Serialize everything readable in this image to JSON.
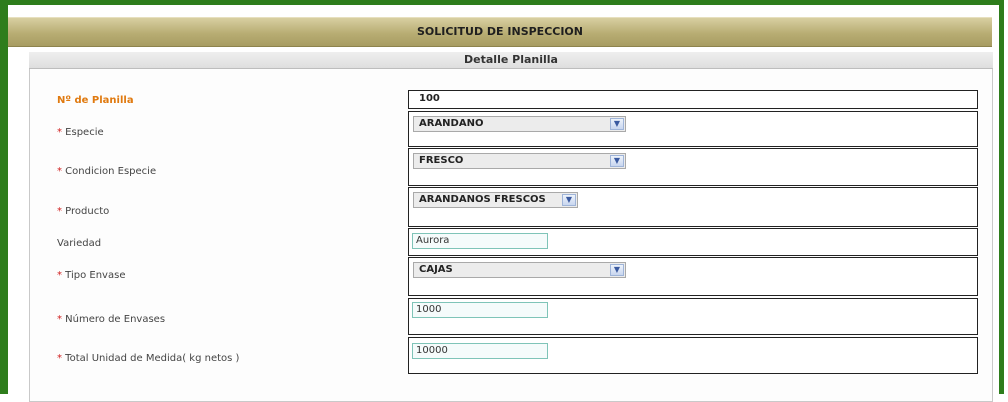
{
  "title": "SOLICITUD DE INSPECCION",
  "section": "Detalle Planilla",
  "fields": {
    "planilla": {
      "label": "Nº de Planilla",
      "value": "100"
    },
    "especie": {
      "req": "*",
      "label": " Especie",
      "value": "ARANDANO"
    },
    "condicion": {
      "req": "*",
      "label": " Condicion Especie",
      "value": "FRESCO"
    },
    "producto": {
      "req": "*",
      "label": " Producto",
      "value": "ARANDANOS FRESCOS"
    },
    "variedad": {
      "label": "Variedad",
      "value": "Aurora"
    },
    "tipo_envase": {
      "req": "*",
      "label": " Tipo Envase",
      "value": "CAJAS"
    },
    "numero_envases": {
      "req": "*",
      "label": " Número de Envases",
      "value": "1000"
    },
    "total_unidad": {
      "req": "*",
      "label": " Total Unidad de Medida( kg netos )",
      "value": "10000"
    }
  },
  "icons": {
    "dropdown": "chevron-down-icon"
  },
  "colors": {
    "frame": "#2e7d1c",
    "titlebar": "#b8ad73",
    "required": "#d02020",
    "highlight_label": "#e07a10"
  }
}
